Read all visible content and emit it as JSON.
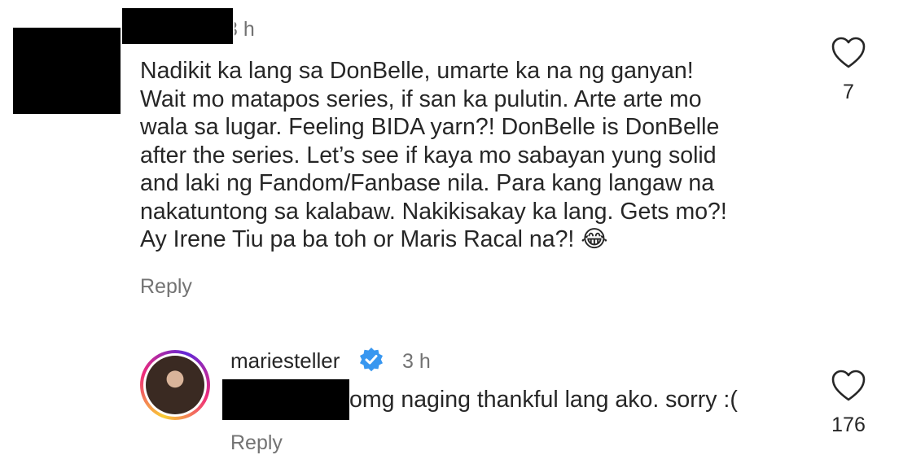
{
  "comment": {
    "time": "3 h",
    "text": "Nadikit ka lang sa DonBelle, umarte ka na ng ganyan!\nWait mo matapos series, if san ka pulutin. Arte arte mo\nwala sa lugar. Feeling BIDA yarn?! DonBelle is DonBelle\nafter the series. Let’s see if kaya mo sabayan yung solid\nand laki ng Fandom/Fanbase nila. Para kang langaw na\nnakatuntong sa kalabaw. Nakikisakay ka lang. Gets mo?!\nAy Irene Tiu pa ba toh or Maris Racal na?! 😂",
    "reply_label": "Reply",
    "likes": "7",
    "like_icon": "heart-outline-icon"
  },
  "reply": {
    "username": "mariesteller",
    "verified_icon": "verified-badge-icon",
    "verified_color": "#3897f0",
    "time": "3 h",
    "text": "omg naging thankful lang ako. sorry :(",
    "reply_label": "Reply",
    "likes": "176",
    "like_icon": "heart-outline-icon"
  }
}
